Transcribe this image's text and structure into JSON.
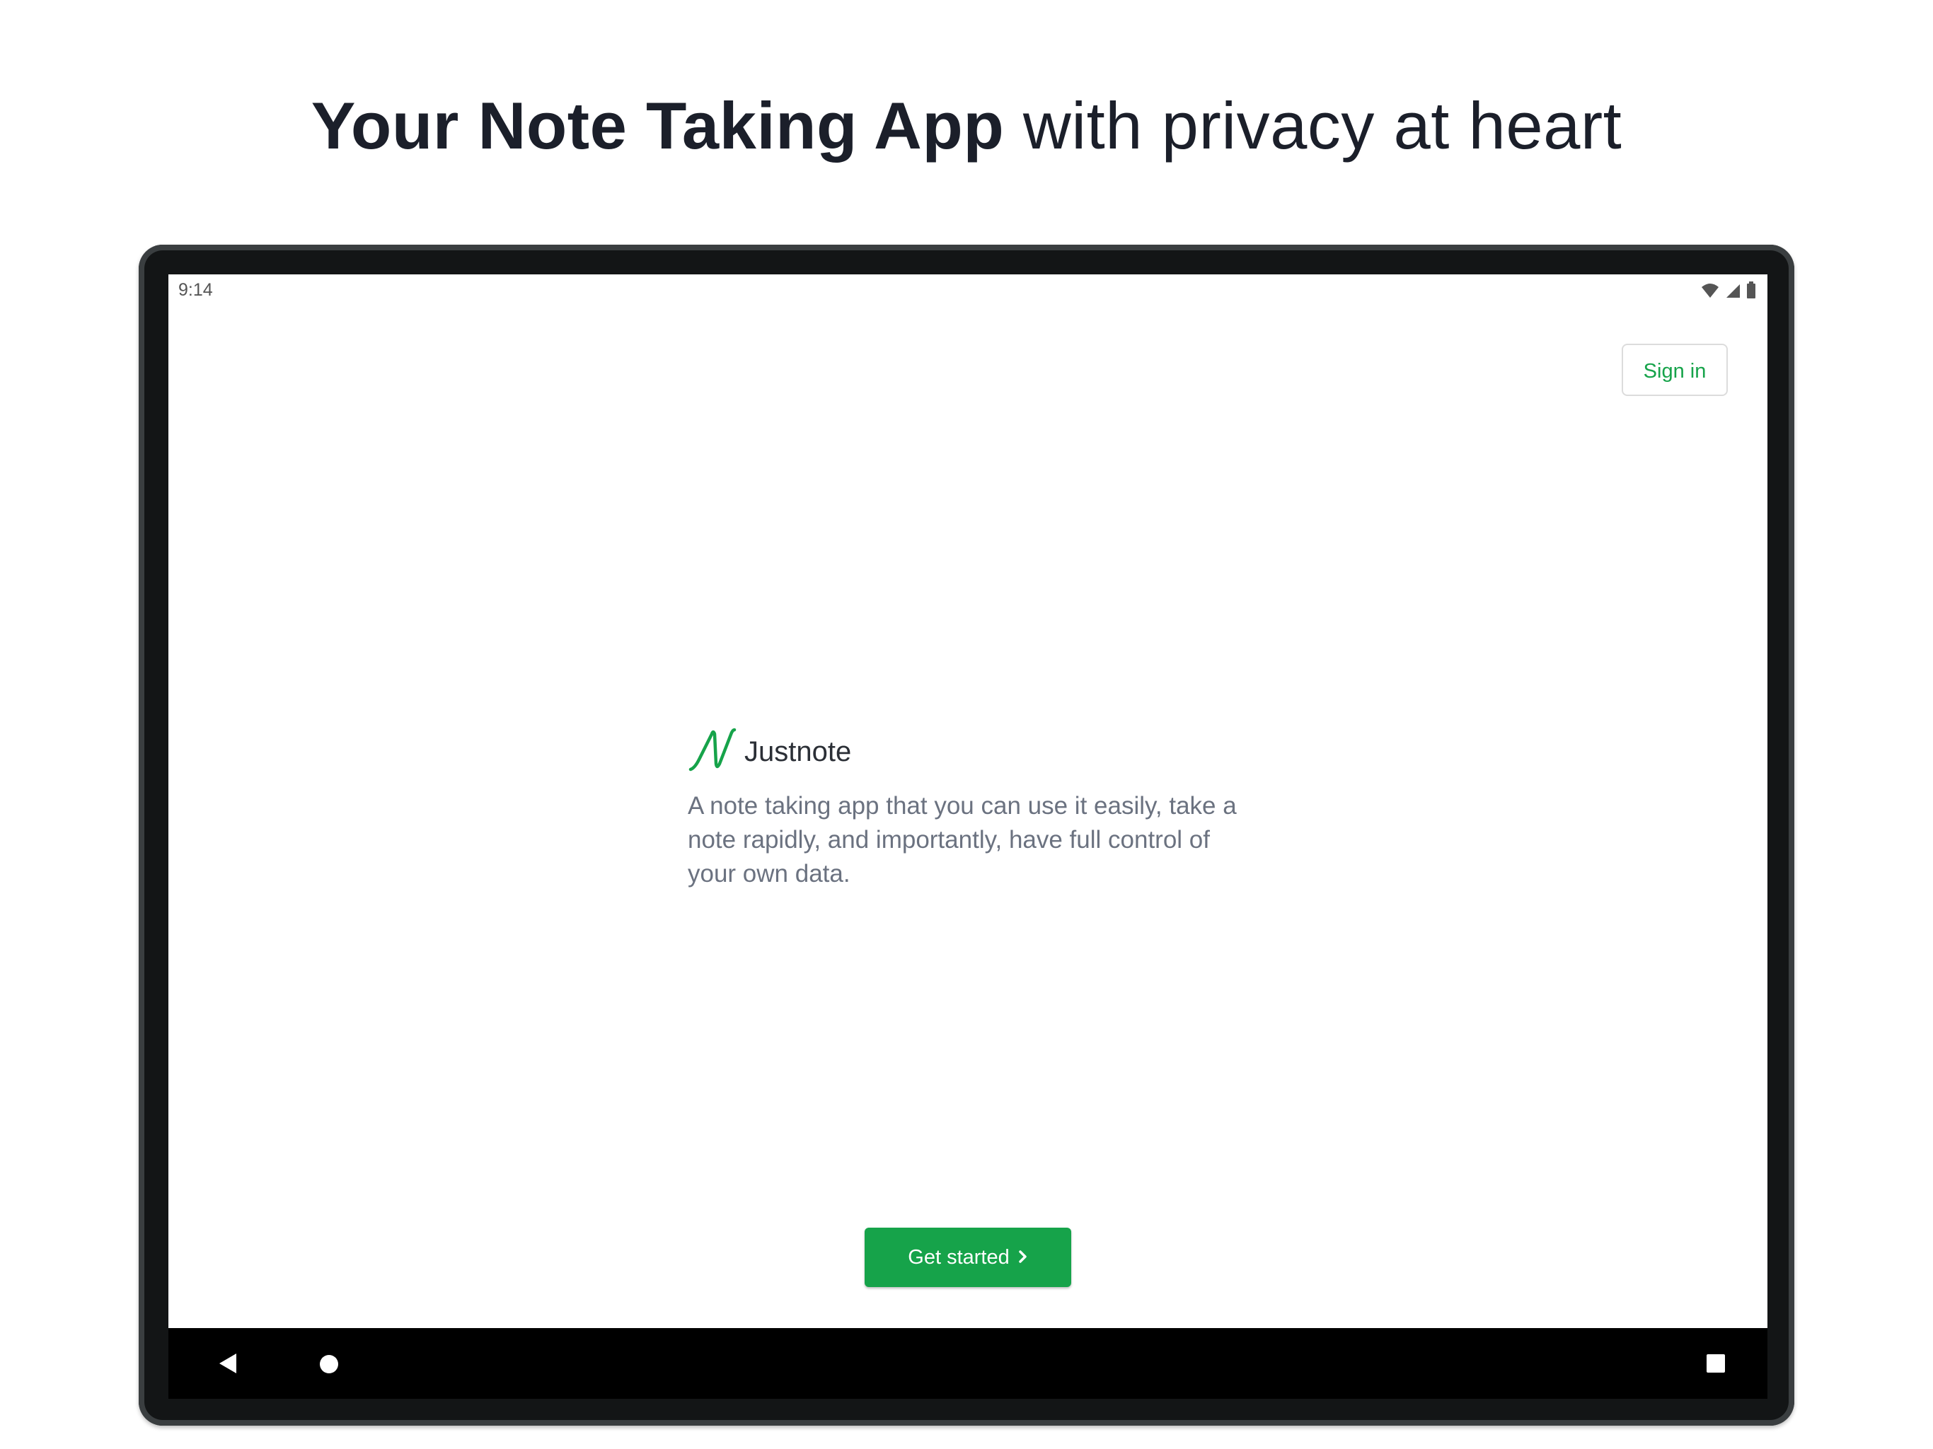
{
  "headline": {
    "bold": "Your Note Taking App",
    "regular": "with privacy at heart"
  },
  "status_bar": {
    "time": "9:14",
    "icons": [
      "wifi-icon",
      "signal-icon",
      "battery-icon"
    ]
  },
  "header": {
    "sign_in_label": "Sign in"
  },
  "hero": {
    "logo_icon": "justnote-logo-icon",
    "brand_name": "Justnote",
    "description": "A note taking app that you can use it easily, take a note rapidly, and importantly, have full control of your own data."
  },
  "cta": {
    "label": "Get started",
    "icon": "chevron-right-icon"
  },
  "nav_bar": {
    "icons": [
      "back-icon",
      "home-icon",
      "recents-icon"
    ]
  },
  "colors": {
    "accent": "#16a34a",
    "headline_text": "#1b1f2a",
    "description_text": "#6b7280",
    "device_frame": "#131516"
  }
}
